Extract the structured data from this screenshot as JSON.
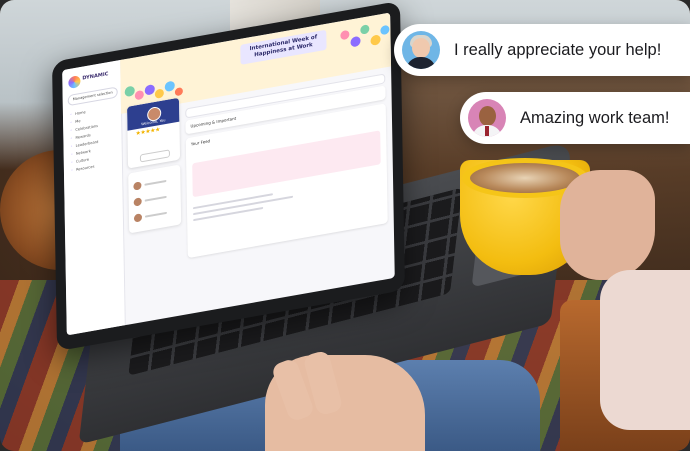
{
  "app": {
    "logo_text": "DYNAMIC",
    "management_pill": "Management selection",
    "banner_title": "International Week of Happiness at Work",
    "welcome": "Welcome, You",
    "stars": "★★★★★",
    "nav_items": [
      "Home",
      "Me",
      "Celebrations",
      "Rewards",
      "Leaderboard",
      "Network",
      "Culture",
      "Resources"
    ],
    "feed_heading_1": "Upcoming & Important",
    "feed_heading_2": "Your Feed"
  },
  "chat": {
    "messages": [
      {
        "text": "I really appreciate your help!",
        "avatar": "woman-avatar"
      },
      {
        "text": "Amazing work team!",
        "avatar": "man-avatar"
      }
    ]
  },
  "colors": {
    "bubble_bg": "#ffffff",
    "cup_yellow": "#f3bd10",
    "app_accent": "#2d3f8f"
  }
}
